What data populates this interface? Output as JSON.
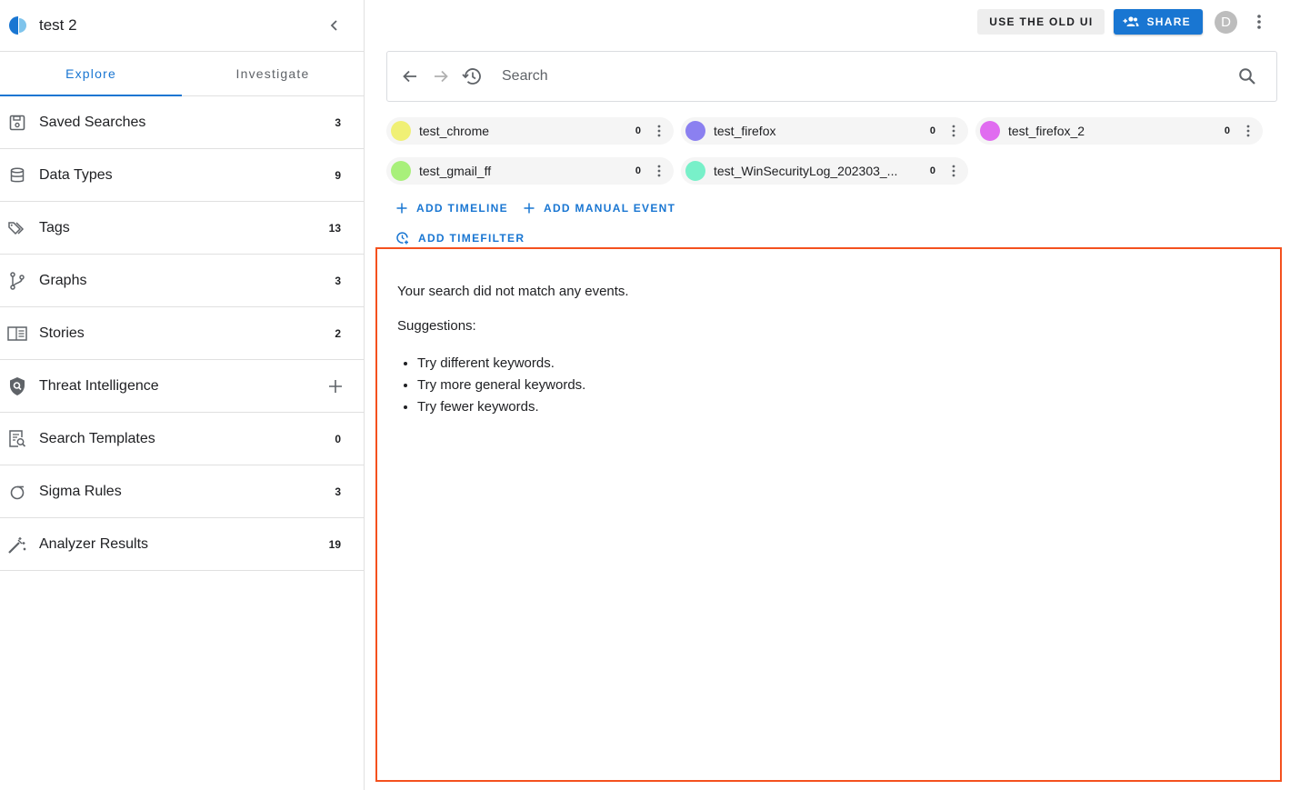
{
  "sketch": {
    "title": "test 2"
  },
  "tabs": [
    {
      "label": "Explore",
      "active": true
    },
    {
      "label": "Investigate",
      "active": false
    }
  ],
  "nav": [
    {
      "label": "Saved Searches",
      "count": "3",
      "icon": "save-icon"
    },
    {
      "label": "Data Types",
      "count": "9",
      "icon": "database-icon"
    },
    {
      "label": "Tags",
      "count": "13",
      "icon": "tags-icon"
    },
    {
      "label": "Graphs",
      "count": "3",
      "icon": "graph-icon"
    },
    {
      "label": "Stories",
      "count": "2",
      "icon": "story-icon"
    },
    {
      "label": "Threat Intelligence",
      "count": "",
      "icon": "shield-icon"
    },
    {
      "label": "Search Templates",
      "count": "0",
      "icon": "search-template-icon"
    },
    {
      "label": "Sigma Rules",
      "count": "3",
      "icon": "sigma-icon"
    },
    {
      "label": "Analyzer Results",
      "count": "19",
      "icon": "magic-wand-icon"
    }
  ],
  "topbar": {
    "old_ui_label": "USE THE OLD UI",
    "share_label": "SHARE",
    "avatar_initial": "D"
  },
  "search": {
    "placeholder": "Search",
    "value": ""
  },
  "timelines": [
    {
      "name": "test_chrome",
      "count": "0",
      "color": "#f0f075"
    },
    {
      "name": "test_firefox",
      "count": "0",
      "color": "#8b80f0"
    },
    {
      "name": "test_firefox_2",
      "count": "0",
      "color": "#e06cf0"
    },
    {
      "name": "test_gmail_ff",
      "count": "0",
      "color": "#a8f07a"
    },
    {
      "name": "test_WinSecurityLog_202303_...",
      "count": "0",
      "color": "#78f0c9"
    }
  ],
  "actions": {
    "add_timeline": "ADD TIMELINE",
    "add_manual_event": "ADD MANUAL EVENT",
    "add_timefilter": "ADD TIMEFILTER"
  },
  "results": {
    "message": "Your search did not match any events.",
    "suggestions_title": "Suggestions:",
    "suggestions": [
      "Try different keywords.",
      "Try more general keywords.",
      "Try fewer keywords."
    ]
  },
  "colors": {
    "accent": "#1976d2",
    "highlight_border": "#f4511e"
  }
}
